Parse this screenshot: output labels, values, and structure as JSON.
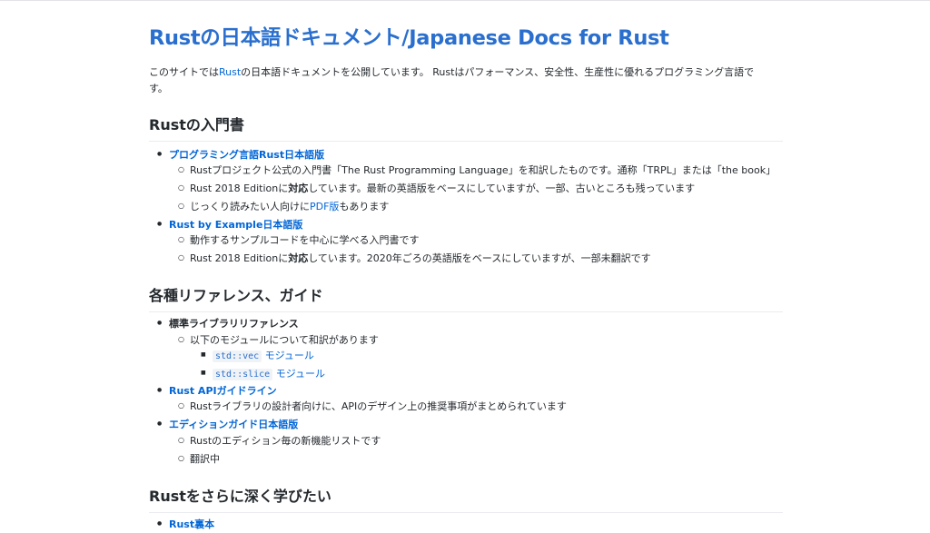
{
  "title": "Rustの日本語ドキュメント/Japanese Docs for Rust",
  "intro": {
    "part1": "このサイトでは",
    "link": "Rust",
    "part2": "の日本語ドキュメントを公開しています。 Rustはパフォーマンス、安全性、生産性に優れるプログラミング言語で",
    "part3": "す。"
  },
  "sections": {
    "book": {
      "heading": "Rustの入門書",
      "item1": {
        "label": "プログラミング言語Rust日本語版",
        "sub1": "Rustプロジェクト公式の入門書「The Rust Programming Language」を和訳したものです。通称「TRPL」または「the book」",
        "sub2a": "Rust 2018 Editionに",
        "sub2b": "対応",
        "sub2c": "しています。最新の英語版をベースにしていますが、一部、古いところも残っています",
        "sub3a": "じっくり読みたい人向けに",
        "sub3link": "PDF版",
        "sub3b": "もあります"
      },
      "item2": {
        "label": "Rust by Example日本語版",
        "sub1": "動作するサンプルコードを中心に学べる入門書です",
        "sub2a": "Rust 2018 Editionに",
        "sub2b": "対応",
        "sub2c": "しています。2020年ごろの英語版をベースにしていますが、一部未翻訳です"
      }
    },
    "reference": {
      "heading": "各種リファレンス、ガイド",
      "item1": {
        "label": "標準ライブラリリファレンス",
        "sub1": "以下のモジュールについて和訳があります",
        "mod1code": "std::vec",
        "mod1text": "モジュール",
        "mod2code": "std::slice",
        "mod2text": "モジュール"
      },
      "item2": {
        "label": "Rust APIガイドライン",
        "sub1": "Rustライブラリの設計者向けに、APIのデザイン上の推奨事項がまとめられています"
      },
      "item3": {
        "label": "エディションガイド日本語版",
        "sub1": "Rustのエディション毎の新機能リストです",
        "sub2": "翻訳中"
      }
    },
    "deep": {
      "heading": "Rustをさらに深く学びたい",
      "item1": {
        "label": "Rust裏本"
      }
    }
  },
  "colors": {
    "link": "#0366d6",
    "title": "#2a6fce",
    "text": "#24292e"
  }
}
